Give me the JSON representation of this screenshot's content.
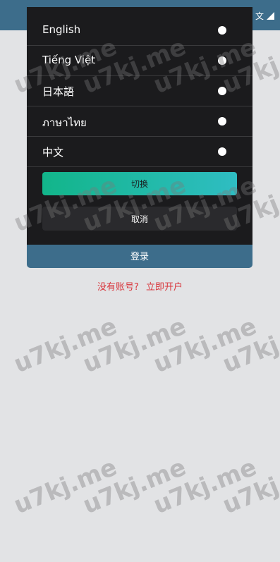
{
  "header": {
    "language_label": "文"
  },
  "modal": {
    "languages": [
      {
        "label": "English"
      },
      {
        "label": "Tiếng Việt"
      },
      {
        "label": "日本語"
      },
      {
        "label": "ภาษาไทย"
      },
      {
        "label": "中文"
      }
    ],
    "switch_label": "切换",
    "cancel_label": "取消"
  },
  "login_label": "登录",
  "register": {
    "prompt": "没有账号?",
    "link": "立即开户"
  },
  "watermark": {
    "text": "u7kj.me"
  },
  "colors": {
    "header": "#3d6d8b",
    "modal_bg": "#1b1b1d",
    "accent_start": "#12b58a",
    "accent_end": "#2fbdc2",
    "link_red": "#d8343a",
    "page_bg": "#e2e3e5"
  }
}
